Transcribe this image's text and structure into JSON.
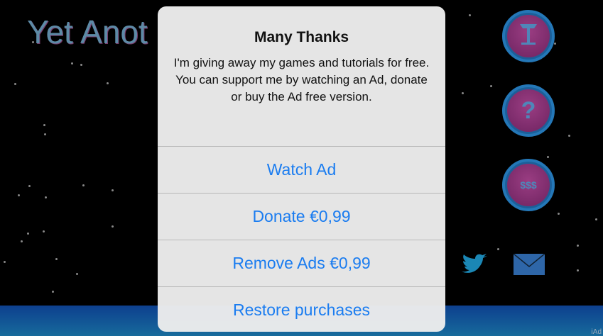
{
  "game": {
    "title": "Yet Anot",
    "side_buttons": [
      {
        "icon": "trophy-icon"
      },
      {
        "icon": "help-icon",
        "glyph": "?"
      },
      {
        "icon": "coins-icon",
        "glyph": "$$$"
      }
    ],
    "social": [
      {
        "icon": "twitter-icon"
      },
      {
        "icon": "mail-icon"
      }
    ],
    "banner_text": "iAd"
  },
  "dialog": {
    "title": "Many Thanks",
    "message": "I'm giving away my games and tutorials for free. You can support me by watching an Ad, donate or buy the Ad free version.",
    "buttons": [
      {
        "label": "Watch Ad"
      },
      {
        "label": "Donate €0,99"
      },
      {
        "label": "Remove Ads €0,99"
      },
      {
        "label": "Restore purchases"
      }
    ]
  },
  "colors": {
    "accent": "#1a7cf0",
    "button_ring": "#2477b7",
    "button_fill": "#8a2f76"
  }
}
